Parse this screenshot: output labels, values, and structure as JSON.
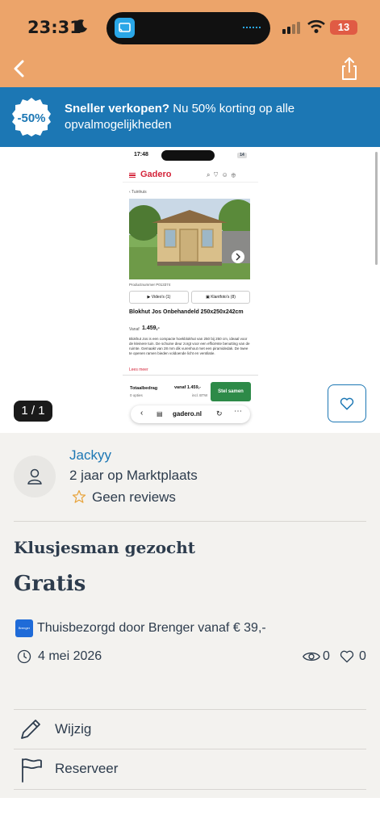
{
  "status_bar": {
    "time": "23:31",
    "battery": "13"
  },
  "promo": {
    "badge": "-50%",
    "headline": "Sneller verkopen?",
    "text": " Nu 50% korting op alle opvalmogelijkheden"
  },
  "gallery": {
    "counter": "1 / 1",
    "screenshot": {
      "time": "17:48",
      "battery": "14",
      "logo": "Gadero",
      "breadcrumb": "Tuinhuis",
      "product_number": "Productnummer P013374",
      "videos_button": "Video's (1)",
      "photos_button": "Klantfoto's (8)",
      "product_title": "Blokhut Jos Onbehandeld 250x250x242cm",
      "price_prefix": "Vanaf",
      "price": "1.459,-",
      "description": "Blokhut Jos is een compacte hoekblokhut van 250 bij 250 cm, ideaal voor de kleinere tuin. De schuine deur zorgt voor een efficiënte benutting van de ruimte. Gemaakt van 28 mm dik vurenhout met een piramidedak. De twee te openen ramen bieden voldoende licht en ventilatie.",
      "read_more": "Lees meer",
      "total_label": "Totaalbedrag",
      "options": "0 opties",
      "total_price": "vanaf 1.459,-",
      "vat": "incl. BTW",
      "cta": "Stel samen",
      "url": "gadero.nl"
    }
  },
  "seller": {
    "name": "Jackyy",
    "member_since": "2 jaar op Marktplaats",
    "reviews": "Geen reviews"
  },
  "listing": {
    "title": "Klusjesman gezocht",
    "price": "Gratis",
    "delivery_logo": "Brenger",
    "delivery": "Thuisbezorgd door Brenger vanaf € 39,-",
    "date": "4 mei 2026",
    "views": "0",
    "favorites": "0"
  },
  "actions": {
    "edit": "Wijzig",
    "reserve": "Reserveer"
  },
  "colors": {
    "header_bg": "#eca46a",
    "promo_bg": "#1c77b4",
    "link": "#1c77b4",
    "text": "#2d3c4d",
    "brand_red": "#d4243a",
    "cta_green": "#2d8a48"
  }
}
